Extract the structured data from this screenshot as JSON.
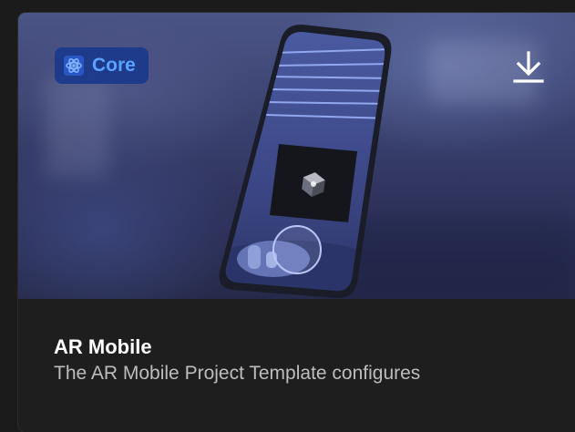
{
  "card": {
    "badge": {
      "label": "Core",
      "icon": "atom-icon",
      "color": "#5aa2ff",
      "background": "#18388c"
    },
    "download_icon": "download-icon",
    "title": "AR Mobile",
    "description": "The AR Mobile Project Template configures"
  },
  "colors": {
    "card_background": "#1e1e1e",
    "title": "#ffffff",
    "description": "#bdbdbd"
  }
}
